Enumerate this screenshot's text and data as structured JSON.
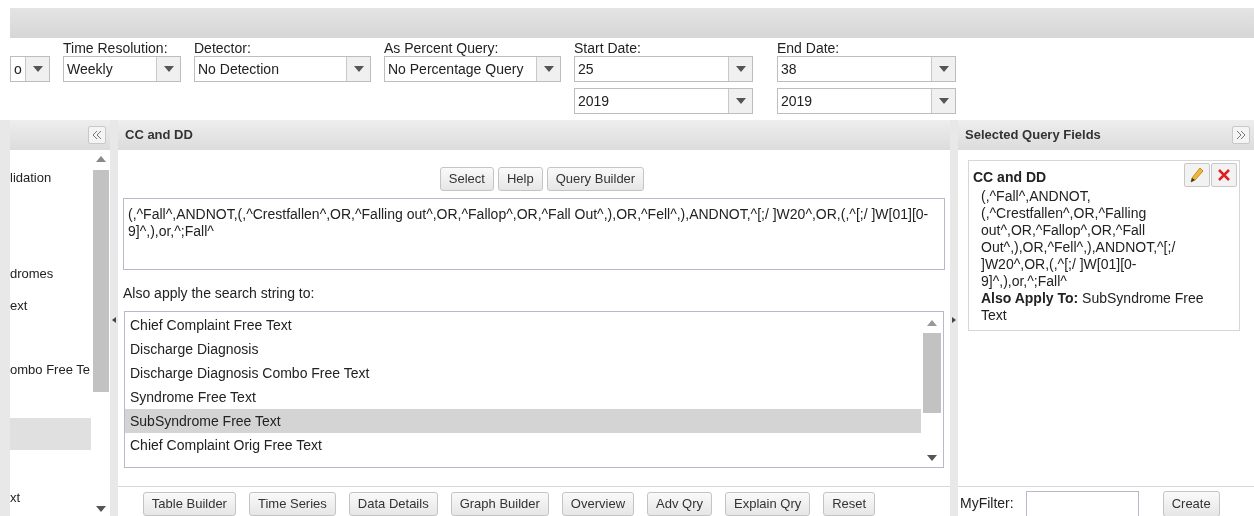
{
  "filters": [
    {
      "value": "o"
    },
    {
      "label": "Time Resolution:",
      "value": "Weekly"
    },
    {
      "label": "Detector:",
      "value": "No Detection"
    },
    {
      "label": "As Percent Query:",
      "value": "No Percentage Query"
    },
    {
      "label": "Start Date:",
      "value": "25",
      "value2": "2019"
    },
    {
      "label": "End Date:",
      "value": "38",
      "value2": "2019"
    }
  ],
  "left_panel": {
    "items": [
      {
        "label": "lidation",
        "selected": false
      },
      {
        "selected": false
      },
      {
        "selected": false
      },
      {
        "label": "dromes",
        "selected": false
      },
      {
        "label": "ext",
        "selected": false
      },
      {
        "selected": false
      },
      {
        "label": "ombo Free Te",
        "selected": false
      },
      {
        "selected": false
      },
      {
        "selected": true
      },
      {
        "selected": false
      },
      {
        "label": "xt",
        "selected": false
      }
    ]
  },
  "center_panel": {
    "title": "CC and DD",
    "buttons": [
      "Select",
      "Help",
      "Query Builder"
    ],
    "query": "(,^Fall^,ANDNOT,(,^Crestfallen^,OR,^Falling out^,OR,^Fallop^,OR,^Fall Out^,),OR,^Fell^,),ANDNOT,^[;/ ]W20^,OR,(,^[;/ ]W[01][0-9]^,),or,^;Fall^",
    "apply_label": "Also apply the search string to:",
    "apply_options": [
      {
        "label": "Chief Complaint Free Text",
        "selected": false
      },
      {
        "label": "Discharge Diagnosis",
        "selected": false
      },
      {
        "label": "Discharge Diagnosis Combo Free Text",
        "selected": false
      },
      {
        "label": "Syndrome Free Text",
        "selected": false
      },
      {
        "label": "SubSyndrome Free Text",
        "selected": true
      },
      {
        "label": "Chief Complaint Orig Free Text",
        "selected": false
      }
    ],
    "footer_buttons": [
      "Table Builder",
      "Time Series",
      "Data Details",
      "Graph Builder",
      "Overview",
      "Adv Qry",
      "Explain Qry",
      "Reset"
    ]
  },
  "right_panel": {
    "title": "Selected Query Fields",
    "card": {
      "title": "CC and DD",
      "text": "(,^Fall^,ANDNOT, (,^Crestfallen^,OR,^Falling out^,OR,^Fallop^,OR,^Fall Out^,),OR,^Fell^,),ANDNOT,^[;/ ]W20^,OR,(,^[;/ ]W[01][0-9]^,),or,^;Fall^",
      "apply": "**Also Apply To:** SubSyndrome Free Text"
    },
    "filter_label": "MyFilter:",
    "create_button": "Create"
  }
}
